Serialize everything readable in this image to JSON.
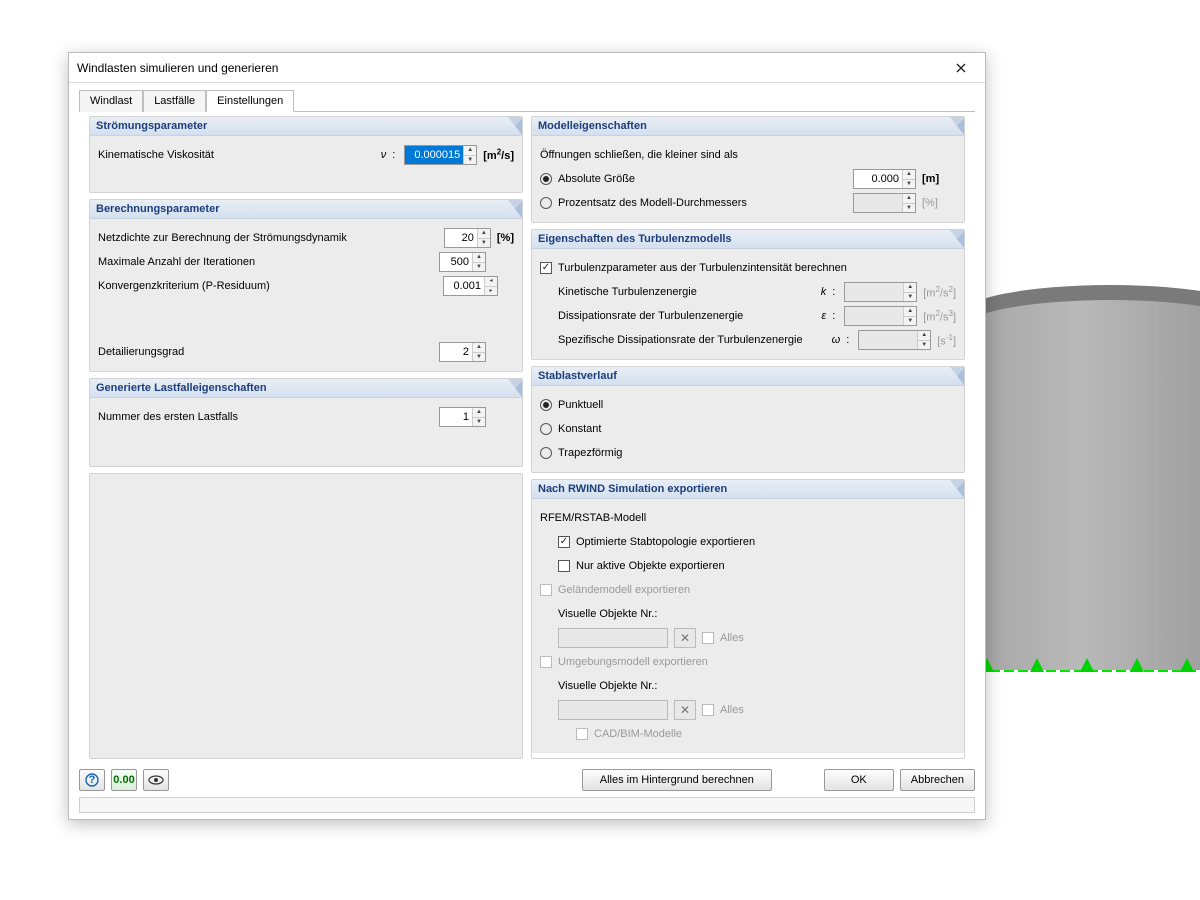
{
  "window": {
    "title": "Windlasten simulieren und generieren"
  },
  "tabs": {
    "t0": "Windlast",
    "t1": "Lastfälle",
    "t2": "Einstellungen"
  },
  "flow": {
    "title": "Strömungsparameter",
    "visc_label": "Kinematische Viskosität",
    "visc_sym": "ν",
    "visc_value": "0.000015",
    "visc_unit": "[m²/s]"
  },
  "calc": {
    "title": "Berechnungsparameter",
    "mesh_label": "Netzdichte zur Berechnung der Strömungsdynamik",
    "mesh_value": "20",
    "mesh_unit": "[%]",
    "iter_label": "Maximale Anzahl der Iterationen",
    "iter_value": "500",
    "conv_label": "Konvergenzkriterium (P-Residuum)",
    "conv_value": "0.001",
    "detail_label": "Detailierungsgrad",
    "detail_value": "2"
  },
  "gen": {
    "title": "Generierte Lastfalleigenschaften",
    "first_label": "Nummer des ersten Lastfalls",
    "first_value": "1"
  },
  "model": {
    "title": "Modelleigenschaften",
    "close_label": "Öffnungen schließen, die kleiner sind als",
    "abs_label": "Absolute Größe",
    "abs_value": "0.000",
    "abs_unit": "[m]",
    "pct_label": "Prozentsatz des Modell-Durchmessers",
    "pct_value": "",
    "pct_unit": "[%]"
  },
  "turb": {
    "title": "Eigenschaften des Turbulenzmodells",
    "chk_label": "Turbulenzparameter aus der Turbulenzintensität berechnen",
    "k_label": "Kinetische Turbulenzenergie",
    "k_sym": "k",
    "k_unit": "[m²/s²]",
    "eps_label": "Dissipationsrate der Turbulenzenergie",
    "eps_sym": "ε",
    "eps_unit": "[m²/s³]",
    "omega_label": "Spezifische Dissipationsrate der Turbulenzenergie",
    "omega_sym": "ω",
    "omega_unit": "[s⁻¹]"
  },
  "load": {
    "title": "Stablastverlauf",
    "r0": "Punktuell",
    "r1": "Konstant",
    "r2": "Trapezförmig"
  },
  "export": {
    "title": "Nach  RWIND Simulation exportieren",
    "rfem": "RFEM/RSTAB-Modell",
    "opt": "Optimierte Stabtopologie exportieren",
    "active": "Nur aktive Objekte exportieren",
    "terrain": "Geländemodell exportieren",
    "visobj": "Visuelle Objekte Nr.:",
    "alles": "Alles",
    "env": "Umgebungsmodell exportieren",
    "cadbim": "CAD/BIM-Modelle"
  },
  "footer": {
    "bgcalc": "Alles im Hintergrund berechnen",
    "ok": "OK",
    "cancel": "Abbrechen"
  }
}
